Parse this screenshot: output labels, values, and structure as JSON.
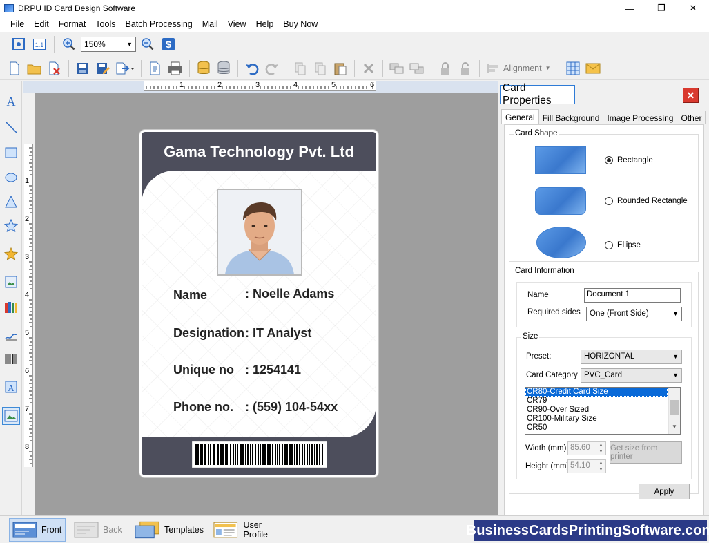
{
  "window": {
    "title": "DRPU ID Card Design Software"
  },
  "menu": [
    {
      "label": "File"
    },
    {
      "label": "Edit"
    },
    {
      "label": "Format"
    },
    {
      "label": "Tools"
    },
    {
      "label": "Batch Processing"
    },
    {
      "label": "Mail"
    },
    {
      "label": "View"
    },
    {
      "label": "Help"
    },
    {
      "label": "Buy Now"
    }
  ],
  "toolbar": {
    "zoom_value": "150%",
    "alignment_label": "Alignment"
  },
  "ruler": {
    "h_marks": [
      "1",
      "2",
      "3",
      "4",
      "5",
      "6"
    ],
    "v_marks": [
      "1",
      "2",
      "3",
      "4",
      "5",
      "6",
      "7",
      "8"
    ]
  },
  "card": {
    "company": "Gama Technology Pvt. Ltd",
    "fields": [
      {
        "label": "Name",
        "value": ": Noelle Adams"
      },
      {
        "label": "Designation",
        "value": ": IT Analyst"
      },
      {
        "label": "Unique no",
        "value": ": 1254141"
      },
      {
        "label": "Phone no.",
        "value": ": (559) 104-54xx"
      }
    ],
    "header_color": "#4d4e5c"
  },
  "panel": {
    "title": "Card Properties",
    "tabs": [
      "General",
      "Fill Background",
      "Image Processing",
      "Other"
    ],
    "card_shape": {
      "legend": "Card Shape",
      "options": [
        {
          "label": "Rectangle",
          "selected": true
        },
        {
          "label": "Rounded Rectangle",
          "selected": false
        },
        {
          "label": "Ellipse",
          "selected": false
        }
      ]
    },
    "card_info": {
      "legend": "Card Information",
      "name_label": "Name",
      "name_value": "Document 1",
      "sides_label": "Required sides",
      "sides_value": "One (Front Side)"
    },
    "size": {
      "legend": "Size",
      "preset_label": "Preset:",
      "preset_value": "HORIZONTAL",
      "category_label": "Card Category",
      "category_value": "PVC_Card",
      "list": [
        "CR80-Credit Card Size",
        "CR79",
        "CR90-Over Sized",
        "CR100-Military Size",
        "CR50"
      ],
      "selected_index": 0,
      "width_label": "Width  (mm)",
      "width_value": "85.60",
      "height_label": "Height  (mm)",
      "height_value": "54.10",
      "printer_button": "Get size from printer"
    },
    "apply_button": "Apply"
  },
  "bottom": {
    "buttons": [
      {
        "label": "Front"
      },
      {
        "label": "Back"
      },
      {
        "label": "Templates"
      },
      {
        "label": "User Profile"
      }
    ],
    "brand": "BusinessCardsPrintingSoftware.com"
  },
  "colors": {
    "accent": "#0a6ad8",
    "close": "#d9392e",
    "brand_bg": "#2b3a87"
  }
}
